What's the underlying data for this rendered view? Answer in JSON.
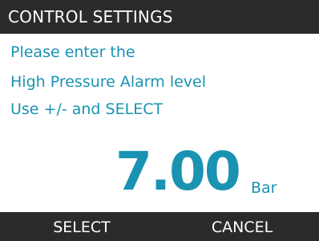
{
  "header": {
    "title": "CONTROL SETTINGS"
  },
  "message": {
    "line1": "Please enter the",
    "line2": "High Pressure Alarm level",
    "line3": "Use +/- and SELECT"
  },
  "reading": {
    "value": "7.00",
    "unit": "Bar"
  },
  "softkeys": {
    "left": "SELECT",
    "right": "CANCEL"
  },
  "colors": {
    "accent": "#1a93b2",
    "bar_background": "#2b2b2b",
    "background": "#ffffff"
  }
}
